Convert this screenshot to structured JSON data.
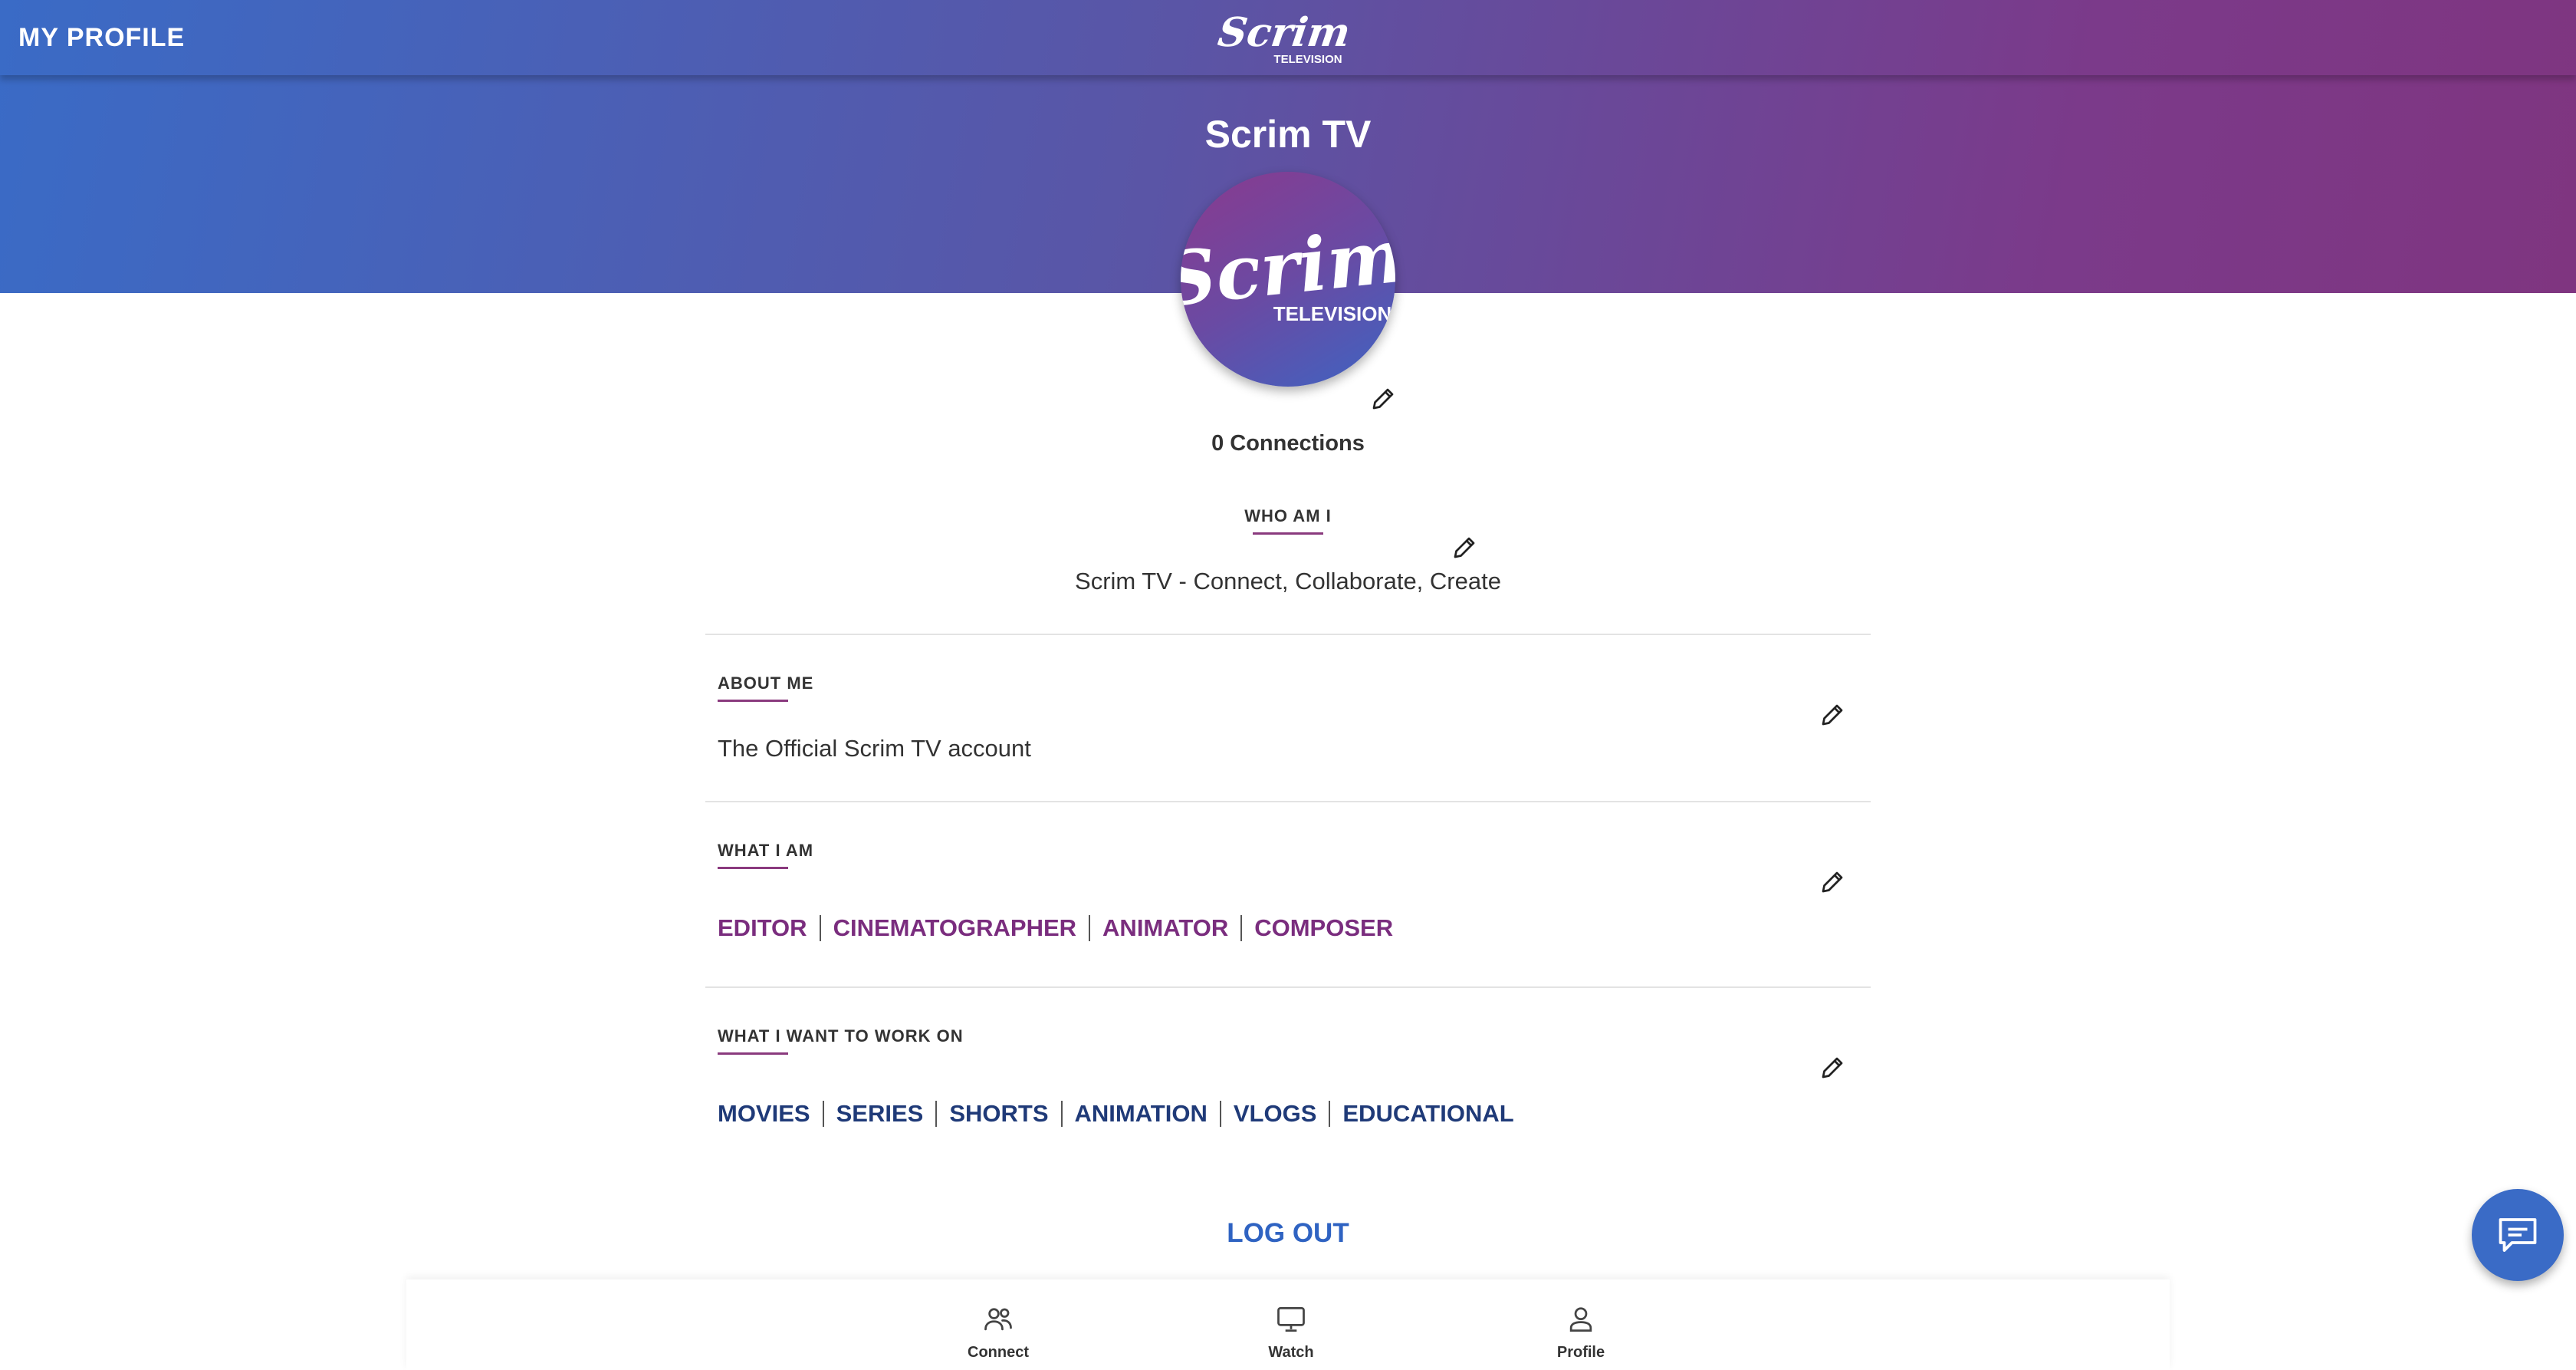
{
  "header": {
    "page_label": "MY PROFILE",
    "logo_text": "Scrim",
    "logo_subtext": "TELEVISION"
  },
  "profile": {
    "name": "Scrim TV",
    "avatar_text": "Scrim",
    "avatar_subtext": "TELEVISION",
    "connections": "0 Connections"
  },
  "who_am_i": {
    "label": "WHO AM I",
    "text": "Scrim TV - Connect, Collaborate, Create"
  },
  "about_me": {
    "label": "ABOUT ME",
    "text": "The Official Scrim TV account"
  },
  "what_i_am": {
    "label": "WHAT I AM",
    "tags": [
      "EDITOR",
      "CINEMATOGRAPHER",
      "ANIMATOR",
      "COMPOSER"
    ]
  },
  "work_on": {
    "label": "WHAT I WANT TO WORK ON",
    "tags": [
      "MOVIES",
      "SERIES",
      "SHORTS",
      "ANIMATION",
      "VLOGS",
      "EDUCATIONAL"
    ]
  },
  "logout_label": "LOG OUT",
  "bottom_nav": [
    {
      "label": "Connect",
      "icon": "users-icon"
    },
    {
      "label": "Watch",
      "icon": "monitor-icon"
    },
    {
      "label": "Profile",
      "icon": "user-icon"
    }
  ],
  "colors": {
    "gradient_start": "#3a6bc6",
    "gradient_end": "#7f3580",
    "accent_purple": "#7a2d7e",
    "accent_blue": "#1f3a78",
    "logout_blue": "#2f63c2"
  },
  "chat_icon": "chat-icon"
}
